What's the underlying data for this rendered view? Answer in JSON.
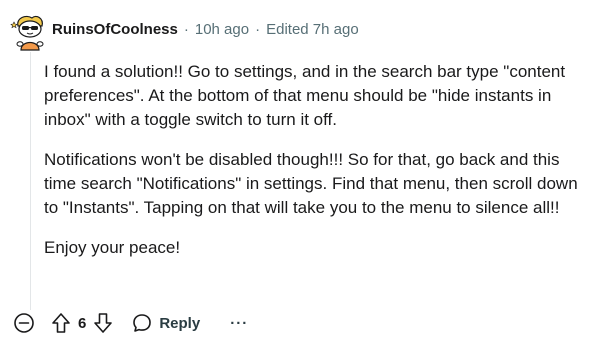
{
  "comment": {
    "author": "RuinsOfCoolness",
    "separator": "·",
    "posted_time": "10h ago",
    "edited_text": "Edited 7h ago",
    "paragraphs": [
      "I found a solution!! Go to settings, and in the search bar type \"content preferences\". At the bottom of that menu should be \"hide instants in inbox\" with a toggle switch to turn it off.",
      "Notifications won't be disabled though!!! So for that, go back and this time search \"Notifications\" in settings. Find that menu, then scroll down to \"Instants\". Tapping on that will take you to the menu to silence all!!",
      "Enjoy your peace!"
    ]
  },
  "actions": {
    "collapse_icon": "collapse-minus-icon",
    "upvote_icon": "upvote-arrow-icon",
    "score": "6",
    "downvote_icon": "downvote-arrow-icon",
    "reply_icon": "speech-bubble-icon",
    "reply_label": "Reply",
    "more_label": "···"
  },
  "colors": {
    "meta_text": "#576f76",
    "body_text": "#1a1a1b",
    "avatar_bg": "#f6d64a"
  }
}
